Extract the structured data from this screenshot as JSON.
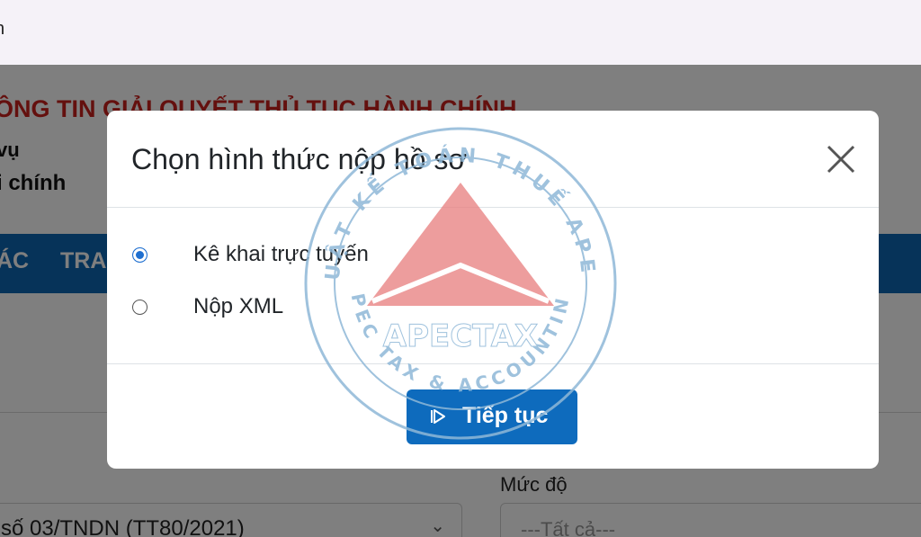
{
  "browser": {
    "address_fragment": "h"
  },
  "portal": {
    "title": "ÔNG TIN GIẢI QUYẾT THỦ TỤC HÀNH CHÍNH",
    "line1": "vụ",
    "line2": "i chính"
  },
  "nav": {
    "items": [
      "ÁC",
      "TRA"
    ]
  },
  "background_form": {
    "form_select_value": "số 03/TNDN (TT80/2021)",
    "level_label": "Mức độ",
    "level_placeholder": "---Tất cả---"
  },
  "modal": {
    "title": "Chọn hình thức nộp hồ sơ",
    "options": [
      {
        "label": "Kê khai trực tuyến",
        "selected": true
      },
      {
        "label": "Nộp XML",
        "selected": false
      }
    ],
    "continue_label": "Tiếp tục"
  },
  "watermark": {
    "brand": "APECTAX",
    "ring_top": "LUẬT KẾ TOÁN THUẾ APEC",
    "ring_bottom": "APEC TAX & ACCOUNTING"
  },
  "colors": {
    "primary": "#0e6bbd",
    "nav": "#0d66b3",
    "title_red": "#c8201c",
    "logo_red": "#e87f80",
    "logo_blue": "#8fb8d8"
  }
}
